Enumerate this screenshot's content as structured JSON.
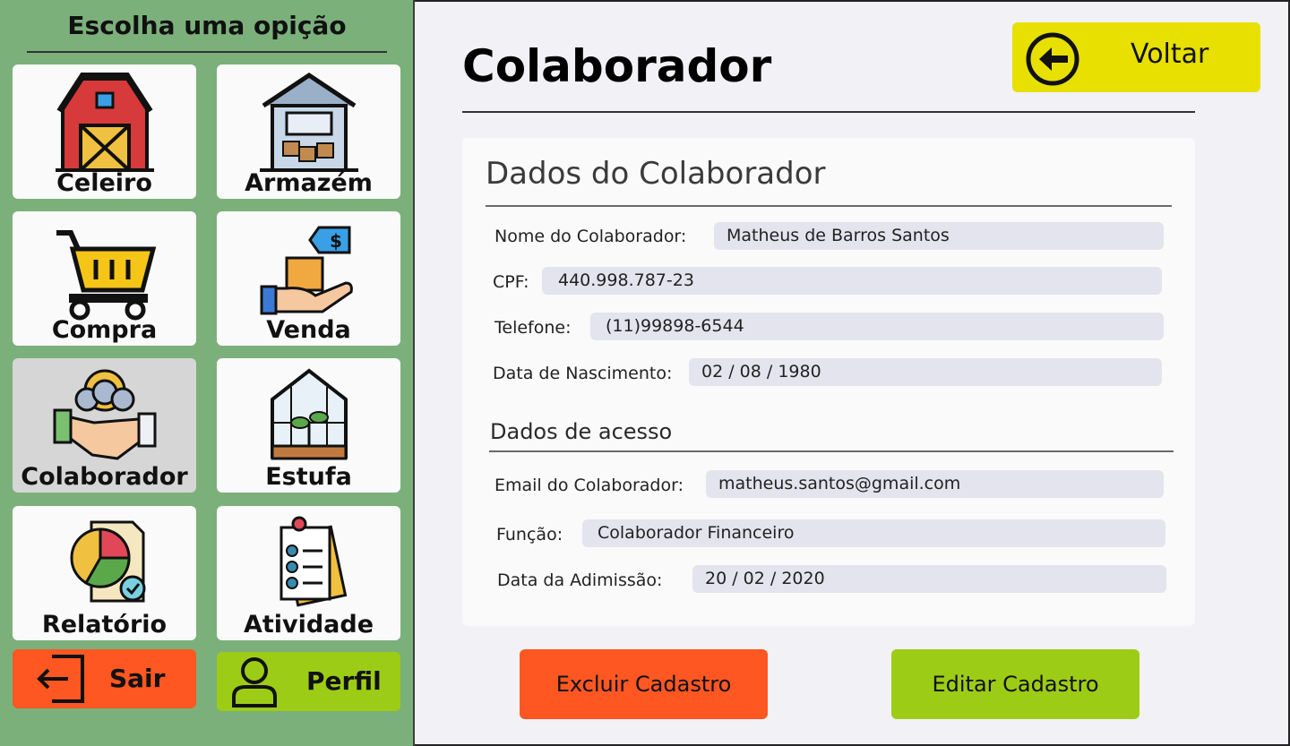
{
  "sidebar": {
    "title": "Escolha uma opição",
    "tiles": [
      {
        "label": "Celeiro",
        "icon": "barn-icon"
      },
      {
        "label": "Armazém",
        "icon": "warehouse-icon"
      },
      {
        "label": "Compra",
        "icon": "shopping-cart-icon"
      },
      {
        "label": "Venda",
        "icon": "sale-hand-icon"
      },
      {
        "label": "Colaborador",
        "icon": "collaborator-handshake-icon"
      },
      {
        "label": "Estufa",
        "icon": "greenhouse-icon"
      },
      {
        "label": "Relatório",
        "icon": "report-chart-icon"
      },
      {
        "label": "Atividade",
        "icon": "task-checklist-icon"
      }
    ],
    "logout_label": "Sair",
    "profile_label": "Perfil"
  },
  "main": {
    "title": "Colaborador",
    "back_label": "Voltar",
    "card_title": "Dados do Colaborador",
    "personal": [
      {
        "label": "Nome do Colaborador:",
        "value": "Matheus de Barros Santos"
      },
      {
        "label": "CPF:",
        "value": "440.998.787-23"
      },
      {
        "label": "Telefone:",
        "value": "(11)99898-6544"
      },
      {
        "label": "Data de Nascimento:",
        "value": "02 / 08 / 1980"
      }
    ],
    "access_title": "Dados de acesso",
    "access": [
      {
        "label": "Email do Colaborador:",
        "value": "matheus.santos@gmail.com"
      },
      {
        "label": "Função:",
        "value": "Colaborador Financeiro"
      },
      {
        "label": "Data da Adimissão:",
        "value": "20 / 02 / 2020"
      }
    ],
    "delete_label": "Excluir Cadastro",
    "edit_label": "Editar Cadastro"
  },
  "colors": {
    "sidebar_bg": "#7bb07b",
    "back_button": "#e7e000",
    "logout_button": "#fe5722",
    "profile_button": "#9dcc16",
    "delete_button": "#fe5722",
    "edit_button": "#9dcc16",
    "field_bg": "#e4e4ee"
  }
}
